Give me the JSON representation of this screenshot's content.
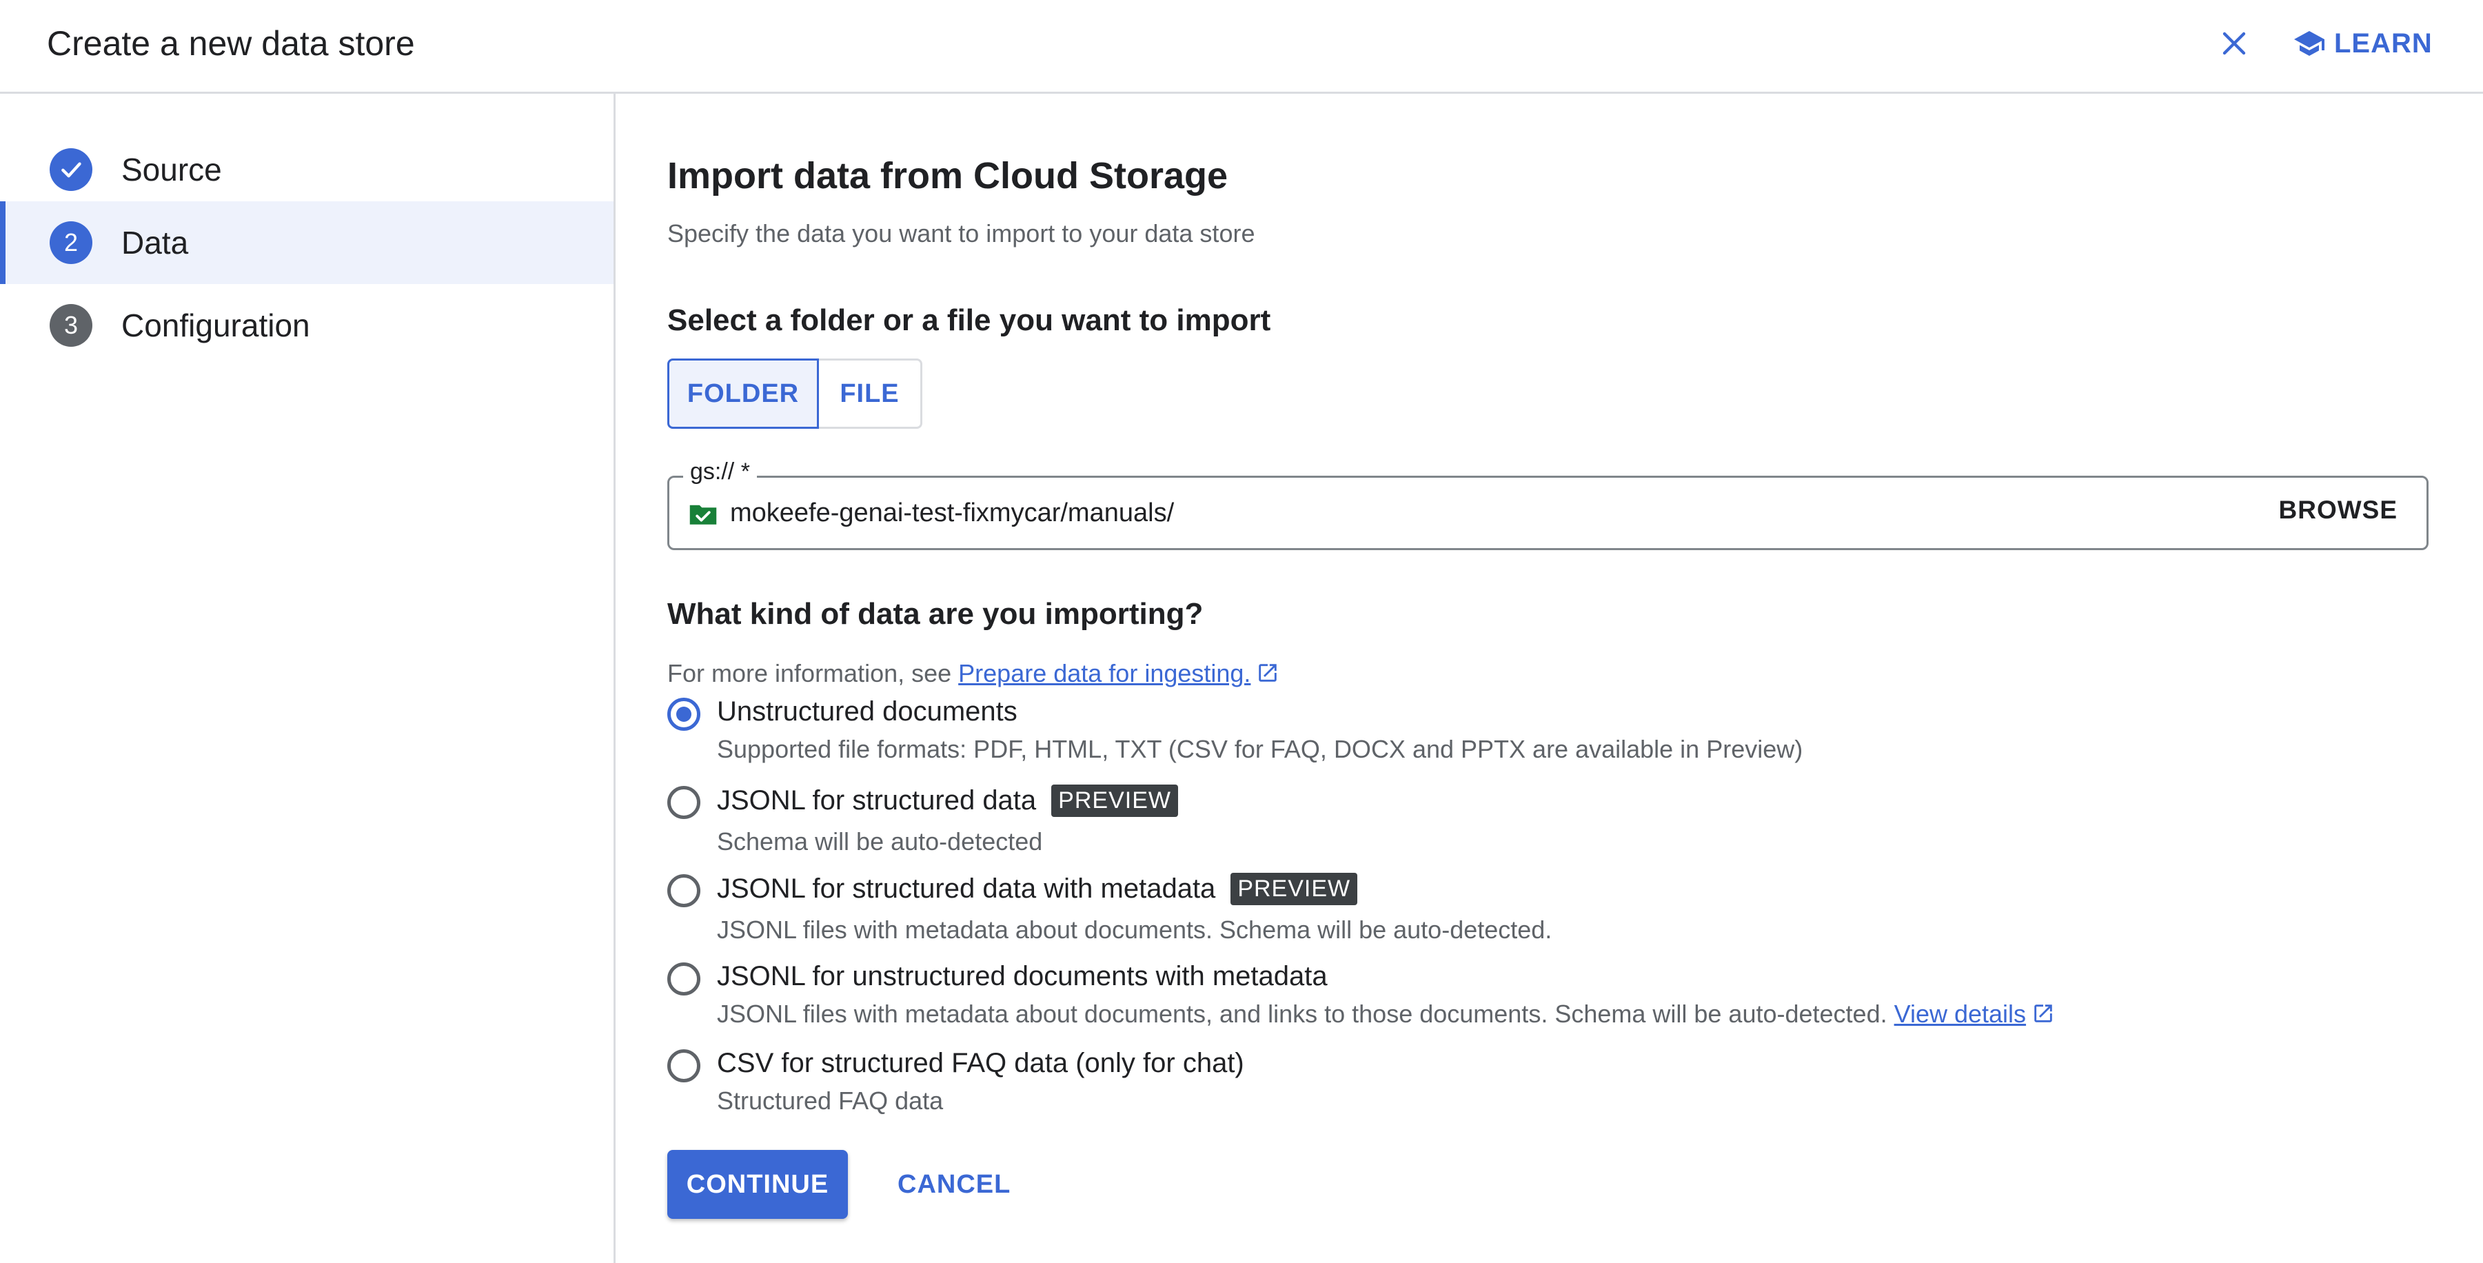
{
  "header": {
    "title": "Create a new data store",
    "close_icon": "close-icon",
    "learn_label": "LEARN",
    "learn_icon": "school-icon"
  },
  "sidebar": {
    "steps": [
      {
        "label": "Source",
        "state": "completed",
        "indicator": "check-icon"
      },
      {
        "label": "Data",
        "state": "active",
        "number": "2"
      },
      {
        "label": "Configuration",
        "state": "pending",
        "number": "3"
      }
    ]
  },
  "main": {
    "title": "Import data from Cloud Storage",
    "subtitle": "Specify the data you want to import to your data store",
    "select_heading": "Select a folder or a file you want to import",
    "toggle": {
      "folder_label": "FOLDER",
      "file_label": "FILE",
      "selected": "FOLDER"
    },
    "path_field": {
      "label": "gs:// *",
      "value": "mokeefe-genai-test-fixmycar/manuals/",
      "status_icon": "bucket-check-icon",
      "browse_label": "BROWSE"
    },
    "kind_heading": "What kind of data are you importing?",
    "info_prefix": "For more information, see ",
    "info_link": "Prepare data for ingesting.",
    "options": [
      {
        "label": "Unstructured documents",
        "desc": "Supported file formats: PDF, HTML, TXT (CSV for FAQ, DOCX and PPTX are available in Preview)",
        "checked": true
      },
      {
        "label": "JSONL for structured data",
        "badge": "PREVIEW",
        "desc": "Schema will be auto-detected",
        "checked": false
      },
      {
        "label": "JSONL for structured data with metadata",
        "badge": "PREVIEW",
        "desc": "JSONL files with metadata about documents. Schema will be auto-detected.",
        "checked": false
      },
      {
        "label": "JSONL for unstructured documents with metadata",
        "desc": "JSONL files with metadata about documents, and links to those documents. Schema will be auto-detected. ",
        "desc_link": "View details",
        "checked": false
      },
      {
        "label": "CSV for structured FAQ data (only for chat)",
        "desc": "Structured FAQ data",
        "checked": false
      }
    ],
    "continue_label": "CONTINUE",
    "cancel_label": "CANCEL"
  },
  "colors": {
    "accent": "#3b68d4",
    "success": "#188038",
    "badge_bg": "#3c4043"
  }
}
